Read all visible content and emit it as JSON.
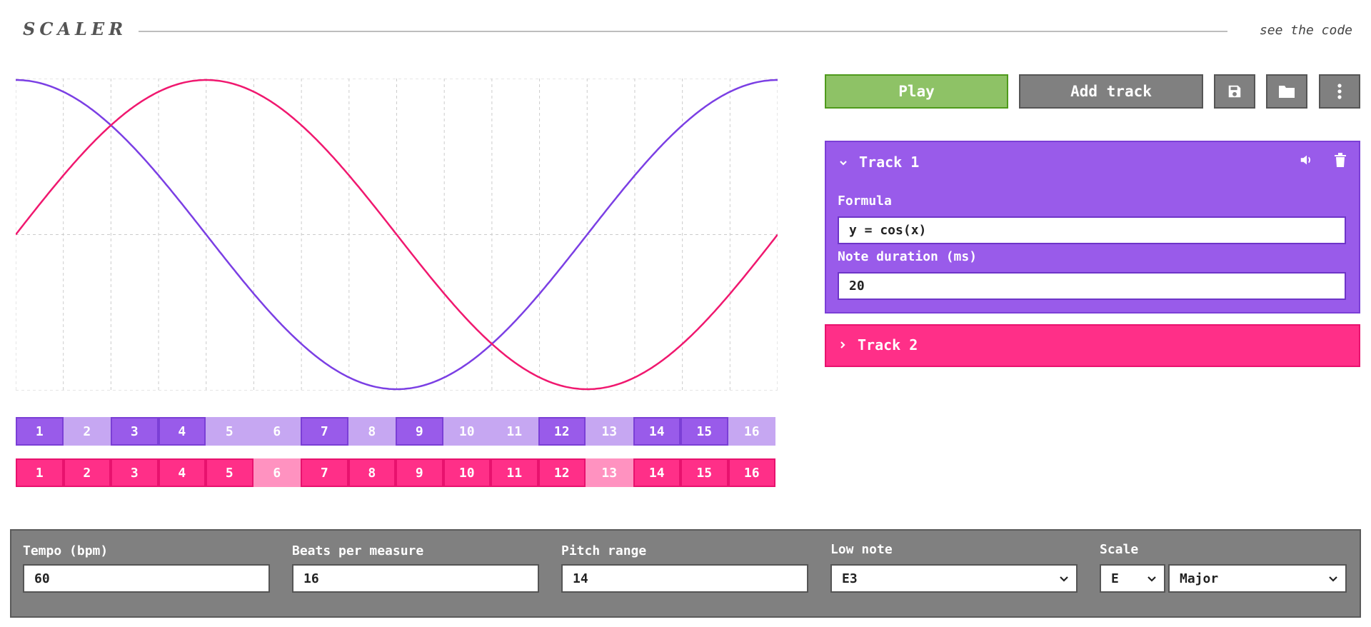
{
  "header": {
    "logo": "SCALER",
    "code_link": "see the code"
  },
  "toolbar": {
    "play_label": "Play",
    "add_track_label": "Add track"
  },
  "tracks": [
    {
      "name": "Track 1",
      "expanded": true,
      "color": "#995bea",
      "formula_label": "Formula",
      "formula_value": "y = cos(x)",
      "duration_label": "Note duration (ms)",
      "duration_value": "20"
    },
    {
      "name": "Track 2",
      "expanded": false,
      "color": "#ff2f88"
    }
  ],
  "pads": {
    "track1": [
      "1",
      "2",
      "3",
      "4",
      "5",
      "6",
      "7",
      "8",
      "9",
      "10",
      "11",
      "12",
      "13",
      "14",
      "15",
      "16"
    ],
    "track1_active": [
      true,
      false,
      true,
      true,
      false,
      false,
      true,
      false,
      true,
      false,
      false,
      true,
      false,
      true,
      true,
      false
    ],
    "track2": [
      "1",
      "2",
      "3",
      "4",
      "5",
      "6",
      "7",
      "8",
      "9",
      "10",
      "11",
      "12",
      "13",
      "14",
      "15",
      "16"
    ],
    "track2_active": [
      true,
      true,
      true,
      true,
      true,
      false,
      true,
      true,
      true,
      true,
      true,
      true,
      false,
      true,
      true,
      true
    ]
  },
  "settings": {
    "tempo_label": "Tempo (bpm)",
    "tempo_value": "60",
    "beats_label": "Beats per measure",
    "beats_value": "16",
    "pitch_label": "Pitch range",
    "pitch_value": "14",
    "low_note_label": "Low note",
    "low_note_value": "E3",
    "scale_label": "Scale",
    "scale_root_value": "E",
    "scale_mode_value": "Major"
  },
  "graph_colors": {
    "track1": "#7b3fe4",
    "track2": "#f0186f",
    "grid": "#cccccc"
  }
}
